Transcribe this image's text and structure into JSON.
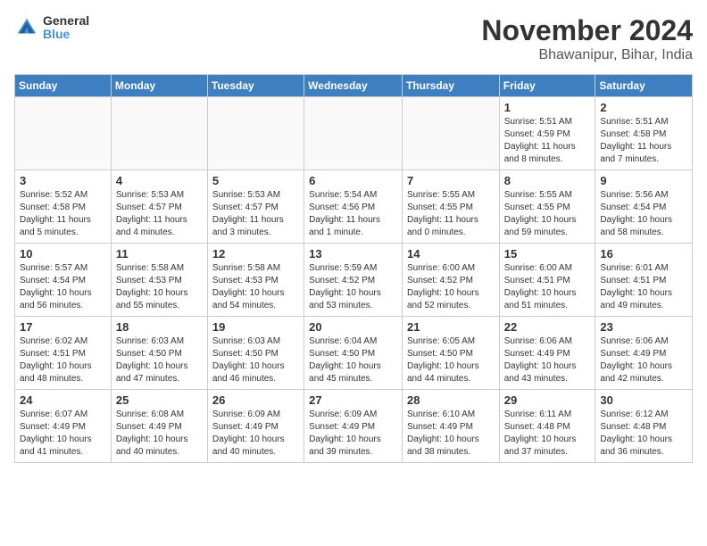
{
  "header": {
    "logo": {
      "general": "General",
      "blue": "Blue"
    },
    "title": "November 2024",
    "subtitle": "Bhawanipur, Bihar, India"
  },
  "weekdays": [
    "Sunday",
    "Monday",
    "Tuesday",
    "Wednesday",
    "Thursday",
    "Friday",
    "Saturday"
  ],
  "weeks": [
    [
      {
        "day": "",
        "info": ""
      },
      {
        "day": "",
        "info": ""
      },
      {
        "day": "",
        "info": ""
      },
      {
        "day": "",
        "info": ""
      },
      {
        "day": "",
        "info": ""
      },
      {
        "day": "1",
        "info": "Sunrise: 5:51 AM\nSunset: 4:59 PM\nDaylight: 11 hours\nand 8 minutes."
      },
      {
        "day": "2",
        "info": "Sunrise: 5:51 AM\nSunset: 4:58 PM\nDaylight: 11 hours\nand 7 minutes."
      }
    ],
    [
      {
        "day": "3",
        "info": "Sunrise: 5:52 AM\nSunset: 4:58 PM\nDaylight: 11 hours\nand 5 minutes."
      },
      {
        "day": "4",
        "info": "Sunrise: 5:53 AM\nSunset: 4:57 PM\nDaylight: 11 hours\nand 4 minutes."
      },
      {
        "day": "5",
        "info": "Sunrise: 5:53 AM\nSunset: 4:57 PM\nDaylight: 11 hours\nand 3 minutes."
      },
      {
        "day": "6",
        "info": "Sunrise: 5:54 AM\nSunset: 4:56 PM\nDaylight: 11 hours\nand 1 minute."
      },
      {
        "day": "7",
        "info": "Sunrise: 5:55 AM\nSunset: 4:55 PM\nDaylight: 11 hours\nand 0 minutes."
      },
      {
        "day": "8",
        "info": "Sunrise: 5:55 AM\nSunset: 4:55 PM\nDaylight: 10 hours\nand 59 minutes."
      },
      {
        "day": "9",
        "info": "Sunrise: 5:56 AM\nSunset: 4:54 PM\nDaylight: 10 hours\nand 58 minutes."
      }
    ],
    [
      {
        "day": "10",
        "info": "Sunrise: 5:57 AM\nSunset: 4:54 PM\nDaylight: 10 hours\nand 56 minutes."
      },
      {
        "day": "11",
        "info": "Sunrise: 5:58 AM\nSunset: 4:53 PM\nDaylight: 10 hours\nand 55 minutes."
      },
      {
        "day": "12",
        "info": "Sunrise: 5:58 AM\nSunset: 4:53 PM\nDaylight: 10 hours\nand 54 minutes."
      },
      {
        "day": "13",
        "info": "Sunrise: 5:59 AM\nSunset: 4:52 PM\nDaylight: 10 hours\nand 53 minutes."
      },
      {
        "day": "14",
        "info": "Sunrise: 6:00 AM\nSunset: 4:52 PM\nDaylight: 10 hours\nand 52 minutes."
      },
      {
        "day": "15",
        "info": "Sunrise: 6:00 AM\nSunset: 4:51 PM\nDaylight: 10 hours\nand 51 minutes."
      },
      {
        "day": "16",
        "info": "Sunrise: 6:01 AM\nSunset: 4:51 PM\nDaylight: 10 hours\nand 49 minutes."
      }
    ],
    [
      {
        "day": "17",
        "info": "Sunrise: 6:02 AM\nSunset: 4:51 PM\nDaylight: 10 hours\nand 48 minutes."
      },
      {
        "day": "18",
        "info": "Sunrise: 6:03 AM\nSunset: 4:50 PM\nDaylight: 10 hours\nand 47 minutes."
      },
      {
        "day": "19",
        "info": "Sunrise: 6:03 AM\nSunset: 4:50 PM\nDaylight: 10 hours\nand 46 minutes."
      },
      {
        "day": "20",
        "info": "Sunrise: 6:04 AM\nSunset: 4:50 PM\nDaylight: 10 hours\nand 45 minutes."
      },
      {
        "day": "21",
        "info": "Sunrise: 6:05 AM\nSunset: 4:50 PM\nDaylight: 10 hours\nand 44 minutes."
      },
      {
        "day": "22",
        "info": "Sunrise: 6:06 AM\nSunset: 4:49 PM\nDaylight: 10 hours\nand 43 minutes."
      },
      {
        "day": "23",
        "info": "Sunrise: 6:06 AM\nSunset: 4:49 PM\nDaylight: 10 hours\nand 42 minutes."
      }
    ],
    [
      {
        "day": "24",
        "info": "Sunrise: 6:07 AM\nSunset: 4:49 PM\nDaylight: 10 hours\nand 41 minutes."
      },
      {
        "day": "25",
        "info": "Sunrise: 6:08 AM\nSunset: 4:49 PM\nDaylight: 10 hours\nand 40 minutes."
      },
      {
        "day": "26",
        "info": "Sunrise: 6:09 AM\nSunset: 4:49 PM\nDaylight: 10 hours\nand 40 minutes."
      },
      {
        "day": "27",
        "info": "Sunrise: 6:09 AM\nSunset: 4:49 PM\nDaylight: 10 hours\nand 39 minutes."
      },
      {
        "day": "28",
        "info": "Sunrise: 6:10 AM\nSunset: 4:49 PM\nDaylight: 10 hours\nand 38 minutes."
      },
      {
        "day": "29",
        "info": "Sunrise: 6:11 AM\nSunset: 4:48 PM\nDaylight: 10 hours\nand 37 minutes."
      },
      {
        "day": "30",
        "info": "Sunrise: 6:12 AM\nSunset: 4:48 PM\nDaylight: 10 hours\nand 36 minutes."
      }
    ]
  ]
}
